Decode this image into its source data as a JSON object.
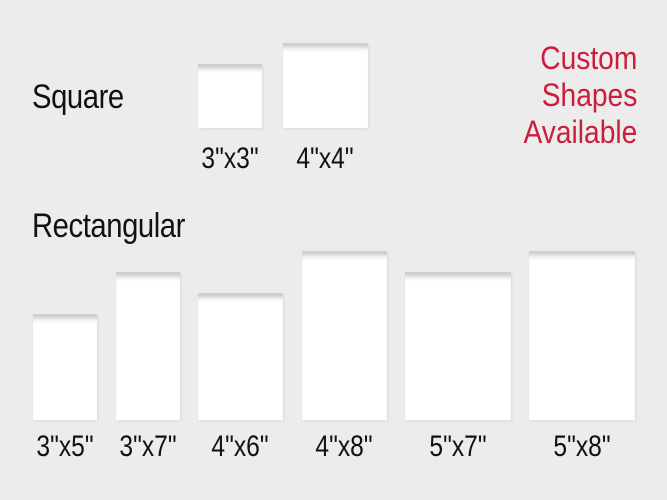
{
  "headings": {
    "square": "Square",
    "rectangular": "Rectangular"
  },
  "custom": {
    "line1": "Custom",
    "line2": "Shapes",
    "line3": "Available"
  },
  "square_sizes": [
    "3\"x3\"",
    "4\"x4\""
  ],
  "rect_sizes": [
    "3\"x5\"",
    "3\"x7\"",
    "4\"x6\"",
    "4\"x8\"",
    "5\"x7\"",
    "5\"x8\""
  ],
  "colors": {
    "background": "#ececed",
    "accent": "#cc1e3c",
    "text": "#111111"
  }
}
